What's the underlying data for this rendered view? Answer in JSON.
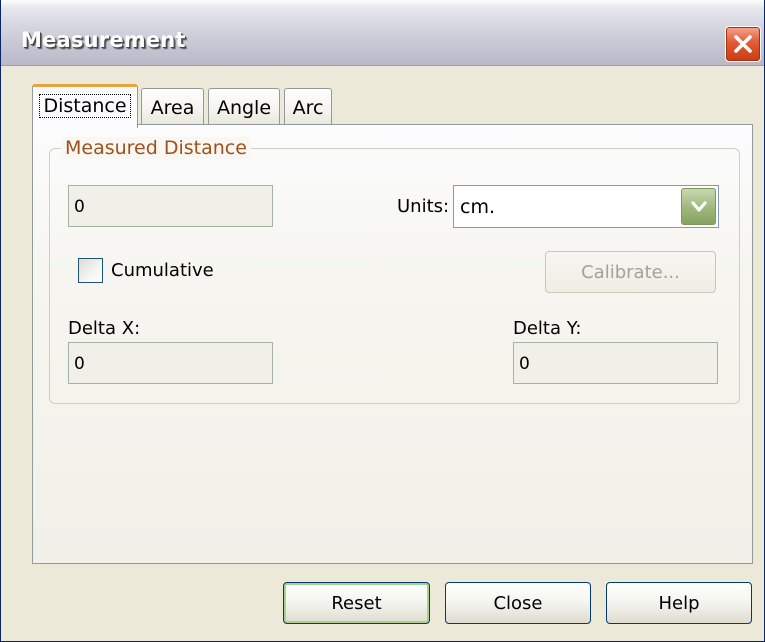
{
  "window": {
    "title": "Measurement"
  },
  "tabs": [
    {
      "label": "Distance",
      "active": true
    },
    {
      "label": "Area",
      "active": false
    },
    {
      "label": "Angle",
      "active": false
    },
    {
      "label": "Arc",
      "active": false
    }
  ],
  "group": {
    "title": "Measured Distance",
    "distance_value": "0",
    "units_label": "Units:",
    "units_selected": "cm.",
    "cumulative_label": "Cumulative",
    "cumulative_checked": false,
    "calibrate_label": "Calibrate...",
    "calibrate_enabled": false,
    "delta_x_label": "Delta X:",
    "delta_x_value": "0",
    "delta_y_label": "Delta Y:",
    "delta_y_value": "0"
  },
  "buttons": {
    "reset_label": "Reset",
    "close_label": "Close",
    "help_label": "Help"
  },
  "icons": {
    "close": "close-x-icon",
    "dropdown": "chevron-down-icon"
  },
  "colors": {
    "dialog_bg": "#ece9d8",
    "group_title": "#a1501d",
    "close_button": "#e25b35",
    "tab_active_accent": "#e8a33c"
  }
}
